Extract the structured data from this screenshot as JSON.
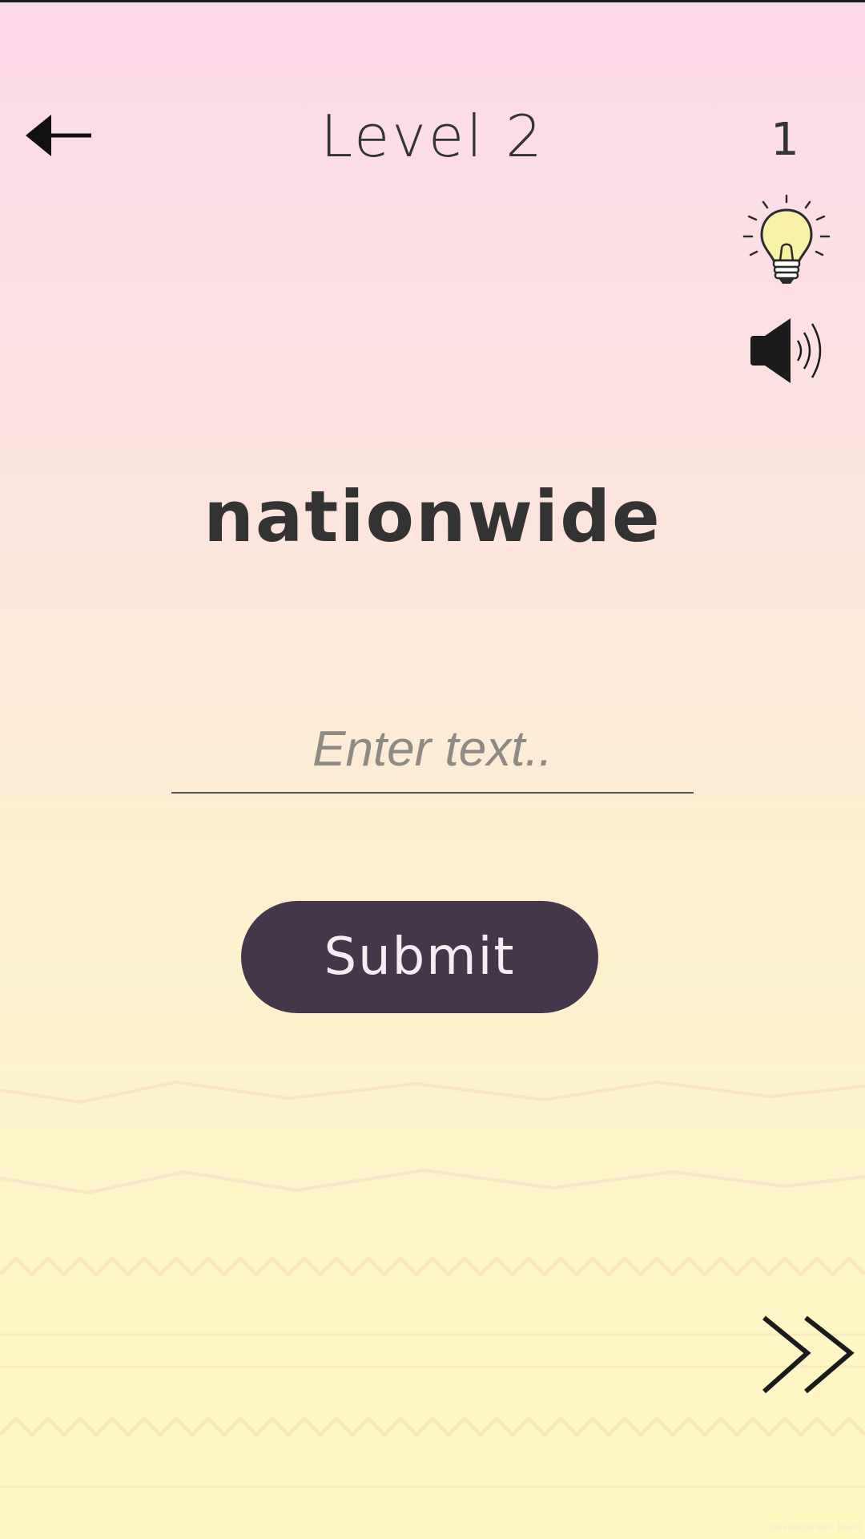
{
  "header": {
    "back_icon": "arrow-left-icon",
    "level_title": "Level 2",
    "hint_count": "1",
    "hint_icon": "lightbulb-icon",
    "sound_icon": "speaker-volume-icon"
  },
  "puzzle": {
    "word": "nationwide"
  },
  "answer": {
    "value": "",
    "placeholder": "Enter text.."
  },
  "actions": {
    "submit_label": "Submit",
    "skip_icon": "double-chevron-right-icon"
  },
  "footer": {
    "build_label": "Development Build"
  },
  "colors": {
    "background_top": "#fcd9ea",
    "background_bottom": "#fdf8c0",
    "text_dark": "#333333",
    "submit_button": "#45374a",
    "submit_text": "#f7ecf3",
    "bulb_fill": "#f8f2a8"
  }
}
